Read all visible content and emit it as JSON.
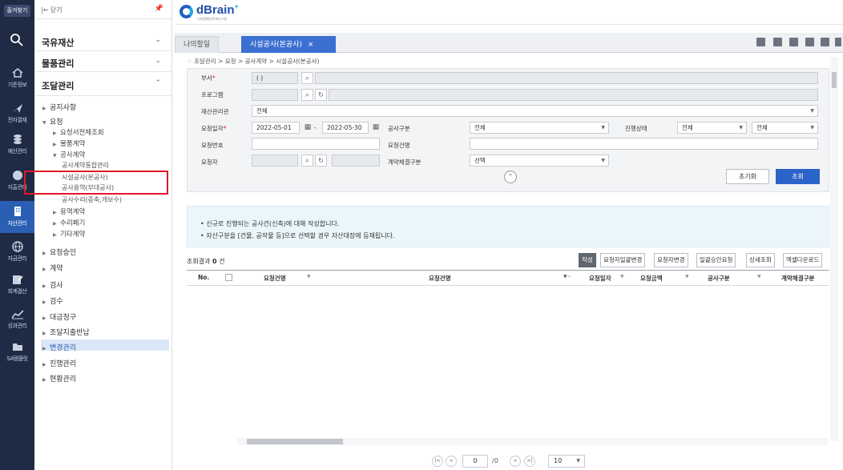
{
  "rail": {
    "favorites": "즐겨찾기",
    "items": [
      "기준정보",
      "전자결재",
      "예산관리",
      "지출관리",
      "자산관리",
      "자금관리",
      "회계결산",
      "성과관리",
      "SA템플릿"
    ]
  },
  "menu": {
    "close_label": "|← 닫기",
    "sections": [
      {
        "label": "국유재산",
        "chev": "⌄"
      },
      {
        "label": "물품관리",
        "chev": "⌄"
      },
      {
        "label": "조달관리",
        "chev": "⌃"
      }
    ],
    "items": {
      "notice": "공지사항",
      "request": "요청",
      "req_all": "요청서전체조회",
      "goods": "물품계약",
      "construction": "공사계약",
      "c_integrated": "공사계약통합관리",
      "c_main": "시설공사(본공사)",
      "c_service": "공사용역(부대공사)",
      "c_repair": "공사수리(증축,개보수)",
      "service": "용역계약",
      "repair_scrap": "수리폐기",
      "other": "기타계약",
      "approval": "요청승인",
      "contract": "계약",
      "inspect": "검사",
      "acceptance": "검수",
      "payment": "대금청구",
      "settle": "조달지출반납",
      "change": "변경관리",
      "progress": "진행관리",
      "status": "현황관리"
    }
  },
  "header": {
    "logo": "dBrain",
    "logo_plus": "+",
    "logo_sub": "디지털예산회계시스템"
  },
  "tabs": [
    {
      "label": "나의할일"
    },
    {
      "label": "시설공사(본공사)",
      "close": "×"
    }
  ],
  "breadcrumb": "조달관리 > 요청 > 공사계약 > 시설공사(본공사)",
  "form": {
    "dept_label": "부서",
    "dept_value": "(        )",
    "program_label": "프로그램",
    "asset_label": "재산관리관",
    "asset_value": "전체",
    "reqdate_label": "요청일자",
    "date_from": "2022-05-01",
    "date_sep": "-",
    "date_to": "2022-05-30",
    "work_type_label": "공사구분",
    "work_type_value": "전체",
    "progress_label": "진행상태",
    "progress_value1": "전체",
    "progress_value2": "전체",
    "reqno_label": "요청번호",
    "reqname_label": "요청건명",
    "requester_label": "요청자",
    "method_label": "계약체결구분",
    "method_value": "선택",
    "reset_label": "초기화",
    "search_label": "조회",
    "collapse": "⌃"
  },
  "notice": [
    "• 신규로 진행되는 공사건(신축)에 대해 작성합니다.",
    "• 자산구분을 [건물, 공작물 등]으로 선택할 경우 자산대장에 등재됩니다."
  ],
  "result": {
    "label": "조회결과",
    "count": "0",
    "unit": "건"
  },
  "actions": [
    "작성",
    "요청자일괄변경",
    "요청자변경",
    "일괄승인요청",
    "상세조회",
    "엑셀다운로드"
  ],
  "grid": {
    "headers": [
      "No.",
      "요청건명",
      "요청건명",
      "요청일자",
      "요청금액",
      "공사구분",
      "계약체결구분"
    ]
  },
  "pager": {
    "page": "0",
    "total": "/0",
    "size": "10"
  }
}
